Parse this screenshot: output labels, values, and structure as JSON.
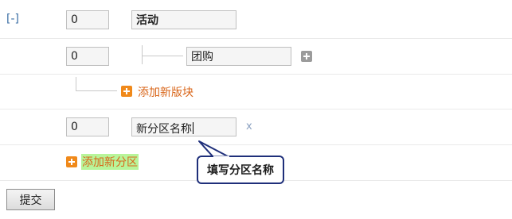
{
  "toggle": {
    "label": "[-]"
  },
  "section": {
    "order": "0",
    "name": "活动",
    "blocks": [
      {
        "order": "0",
        "name": "团购"
      }
    ],
    "add_block_label": "添加新版块"
  },
  "new_section": {
    "order": "0",
    "name": "新分区名称",
    "delete_label": "x"
  },
  "add_section_label": "添加新分区",
  "tooltip": {
    "text": "填写分区名称"
  },
  "submit_label": "提交",
  "colors": {
    "accent_orange": "#f0891a",
    "link_orange": "#d9661a",
    "highlight_green": "#b8f59a",
    "tooltip_border": "#1f2f7a",
    "toggle_blue": "#3a6ea5"
  }
}
